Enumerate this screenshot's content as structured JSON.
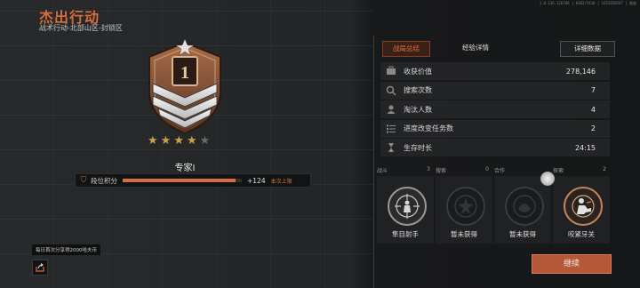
{
  "version": "1.0.136.126780 | 0402/5430 | 1652858567 | 美服",
  "header": {
    "title": "杰出行动",
    "subtitle": "战术行动-北部山区-封锁区"
  },
  "rank": {
    "name": "专家I",
    "stars_filled": 4,
    "stars_total": 5,
    "bar_label": "段位积分",
    "progress": 0.95,
    "delta": "+124",
    "tag": "本次上限",
    "badge_number": "1"
  },
  "tip": "每日首次分享得2000哈夫币",
  "tabs": {
    "summary": "战局总结",
    "experience": "经验详情",
    "detail": "详细数据"
  },
  "stats": [
    {
      "icon": "bag-icon",
      "label": "收获价值",
      "value": "278,146"
    },
    {
      "icon": "search-icon",
      "label": "搜索次数",
      "value": "7"
    },
    {
      "icon": "eliminate-icon",
      "label": "淘汰人数",
      "value": "4"
    },
    {
      "icon": "task-list-icon",
      "label": "进度改变任务数",
      "value": "2"
    },
    {
      "icon": "hourglass-icon",
      "label": "生存时长",
      "value": "24:15"
    }
  ],
  "achievements": [
    {
      "category": "战斗",
      "count": "3",
      "label": "隼目射手",
      "state": "earned"
    },
    {
      "category": "搜索",
      "count": "0",
      "label": "暂未获得",
      "state": "none"
    },
    {
      "category": "合作",
      "count": "",
      "label": "暂未获得",
      "state": "none"
    },
    {
      "category": "探索",
      "count": "2",
      "label": "咬紧牙关",
      "state": "earned"
    }
  ],
  "continue_label": "继续",
  "colors": {
    "accent": "#d76c3c",
    "button": "#b5583a",
    "star": "#c9a24a"
  }
}
